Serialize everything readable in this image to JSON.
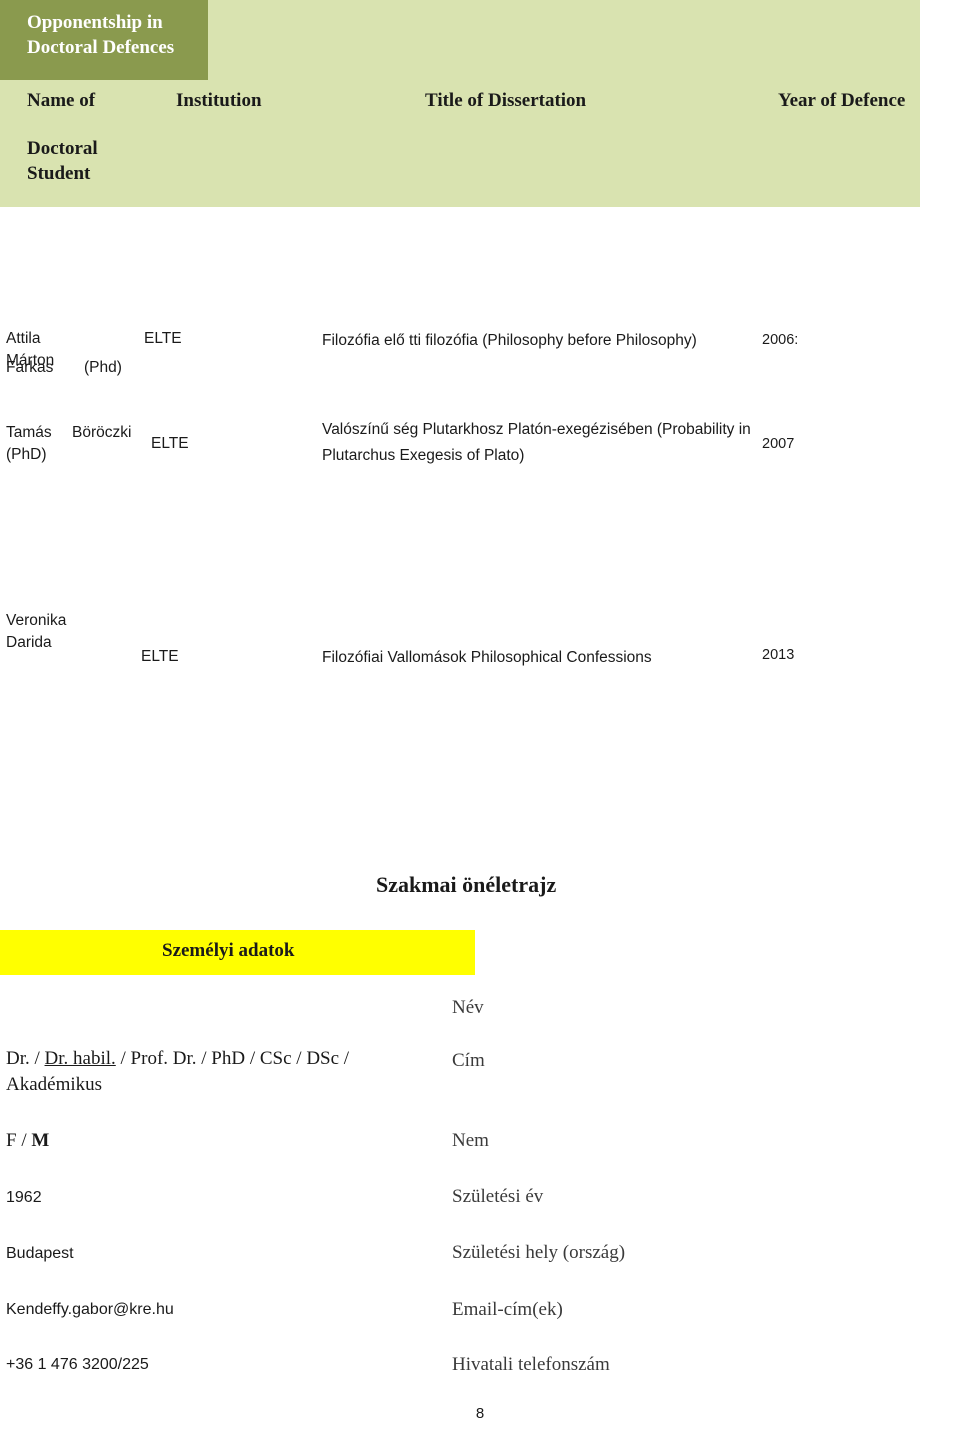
{
  "table": {
    "corner_header": {
      "line1": "Opponentship in",
      "line2": "Doctoral Defences"
    },
    "columns": {
      "name": "Name of",
      "name_sub1": "Doctoral",
      "name_sub2": "Student",
      "institution": "Institution",
      "title": "Title of Dissertation",
      "year": "Year of Defence"
    },
    "rows": [
      {
        "name_line1": "Attila Márton",
        "name_line2": "Farkas",
        "name_line2b": "(Phd)",
        "institution": "ELTE",
        "title": "Filozófia elő tti filozófia (Philosophy before Philosophy)",
        "year": "2006:"
      },
      {
        "name_line1": "Tamás",
        "name_line1b": "Böröczki",
        "name_line2": "(PhD)",
        "institution": "ELTE",
        "title": "Valószínű ség Plutarkhosz Platón-exegézisében (Probability in Plutarchus Exegesis of Plato)",
        "year": "2007"
      },
      {
        "name_line1": "Veronika Darida",
        "institution": "ELTE",
        "title": "Filozófiai Vallomások Philosophical Confessions",
        "year": "2013"
      }
    ]
  },
  "cv": {
    "heading": "Szakmai önéletrajz",
    "section_label": "Személyi adatok",
    "highlight_color": "#ffff00",
    "fields": [
      {
        "value": "",
        "label": "Név"
      },
      {
        "value_prefix": "Dr. / ",
        "value_underline": "Dr. habil.",
        "value_mid": " / Prof. Dr. / PhD / CSc / DSc / ",
        "value_line2": "Akadémikus",
        "label": "Cím"
      },
      {
        "value_prefix": "F / ",
        "value_bold": "M",
        "label": "Nem"
      },
      {
        "value": "1962",
        "label": "Születési év"
      },
      {
        "value": "Budapest",
        "label": "Születési hely (ország)"
      },
      {
        "value": "Kendeffy.gabor@kre.hu",
        "label": "Email-cím(ek)"
      },
      {
        "value": "+36 1 476 3200/225",
        "label": "Hivatali telefonszám"
      }
    ]
  },
  "page_number": "8"
}
